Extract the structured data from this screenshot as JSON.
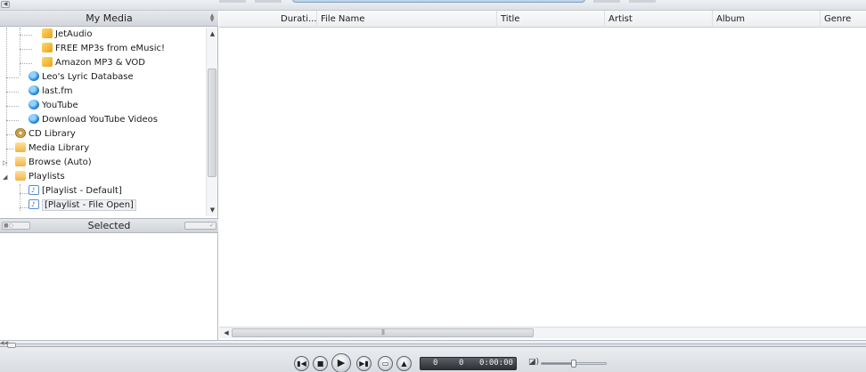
{
  "left_panel": {
    "title": "My Media",
    "tree": [
      {
        "label": "JetAudio",
        "icon": "plugin-icon"
      },
      {
        "label": "FREE MP3s from eMusic!",
        "icon": "plugin-icon"
      },
      {
        "label": "Amazon MP3 & VOD",
        "icon": "plugin-icon"
      },
      {
        "label": "Leo's Lyric Database",
        "icon": "globe-icon"
      },
      {
        "label": "last.fm",
        "icon": "globe-icon"
      },
      {
        "label": "YouTube",
        "icon": "globe-icon"
      },
      {
        "label": "Download YouTube Videos",
        "icon": "globe-icon"
      },
      {
        "label": "CD Library",
        "icon": "cd-icon"
      },
      {
        "label": "Media Library",
        "icon": "folder-icon"
      },
      {
        "label": "Browse (Auto)",
        "icon": "folder-icon"
      },
      {
        "label": "Playlists",
        "icon": "folder-icon"
      },
      {
        "label": "[Playlist - Default]",
        "icon": "playlist-icon"
      },
      {
        "label": "[Playlist - File Open]",
        "icon": "playlist-icon",
        "selected": true
      }
    ],
    "selected_bar_label": "Selected"
  },
  "track_list": {
    "columns": [
      "Durati...",
      "File Name",
      "Title",
      "Artist",
      "Album",
      "Genre"
    ]
  },
  "transport": {
    "buttons": [
      "previous-icon",
      "stop-icon",
      "play-icon",
      "next-icon",
      "open-icon",
      "eject-icon"
    ],
    "display": {
      "count_a": "0",
      "count_b": "0",
      "time": "0:00:00"
    },
    "volume_level": 0.5
  }
}
